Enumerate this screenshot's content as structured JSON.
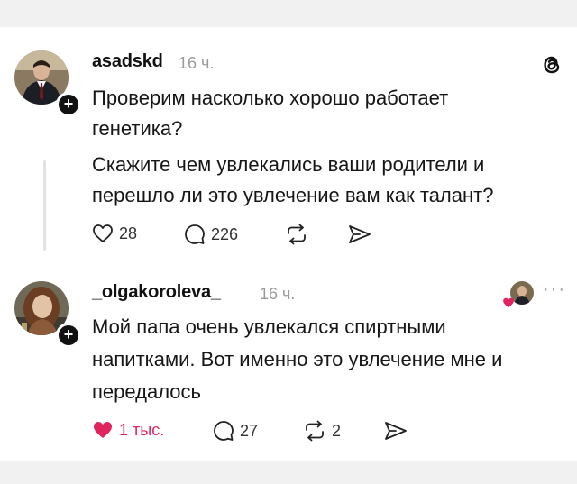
{
  "posts": [
    {
      "username": "asadskd",
      "time": "16 ч.",
      "paragraphs": [
        "Проверим насколько хорошо работает",
        "генетика?",
        "Скажите чем увлекались ваши родители и",
        "перешло ли это увлечение вам как талант?"
      ],
      "likes": "28",
      "comments": "226",
      "reposts": "",
      "icons": [
        "threads-logo-icon",
        "heart-outline-icon",
        "comment-icon",
        "repost-icon",
        "share-icon"
      ]
    },
    {
      "username": "_olgakoroleva_",
      "time": "16 ч.",
      "paragraphs": [
        "Мой папа очень увлекался спиртными",
        "напитками. Вот именно это увлечение мне и",
        "передалось"
      ],
      "likes": "1 тыс.",
      "comments": "27",
      "reposts": "2",
      "more": "···",
      "icons": [
        "author-liked-avatar-icon",
        "more-icon",
        "heart-filled-icon",
        "comment-icon",
        "repost-icon",
        "share-icon"
      ]
    }
  ],
  "colors": {
    "liked": "#e0245e",
    "muted": "#9a9a9a",
    "background": "#f1f1f1",
    "card": "#ffffff"
  }
}
